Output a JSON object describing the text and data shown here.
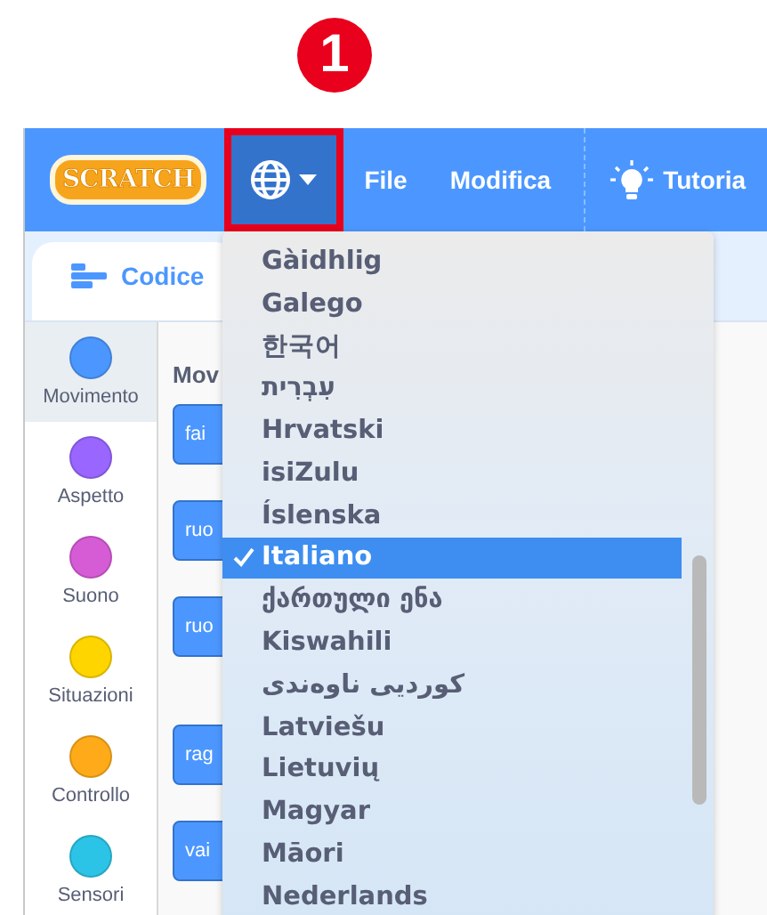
{
  "callout": {
    "label": "1"
  },
  "menu_bar": {
    "items": [
      {
        "kind": "logo",
        "label": "SCRATCH"
      },
      {
        "kind": "language",
        "selected": true
      },
      {
        "kind": "text",
        "label": "File"
      },
      {
        "kind": "text",
        "label": "Modifica"
      },
      {
        "kind": "tutorial",
        "label": "Tutoria"
      }
    ]
  },
  "tabs": [
    {
      "label": "Codice",
      "selected": true
    }
  ],
  "categories": [
    {
      "label": "Movimento",
      "color": "#4c97ff",
      "selected": true
    },
    {
      "label": "Aspetto",
      "color": "#9966ff",
      "selected": false
    },
    {
      "label": "Suono",
      "color": "#d65cd6",
      "selected": false
    },
    {
      "label": "Situazioni",
      "color": "#ffd500",
      "selected": false
    },
    {
      "label": "Controllo",
      "color": "#ffab19",
      "selected": false
    },
    {
      "label": "Sensori",
      "color": "#2cc4e6",
      "selected": false
    }
  ],
  "palette": {
    "heading": "Mov",
    "blocks": [
      "fai",
      "ruo",
      "ruo",
      "rag",
      "vai"
    ]
  },
  "language_menu": {
    "items": [
      {
        "label": "Gàidhlig",
        "selected": false
      },
      {
        "label": "Galego",
        "selected": false
      },
      {
        "label": "한국어",
        "selected": false
      },
      {
        "label": "עִבְרִית",
        "selected": false
      },
      {
        "label": "Hrvatski",
        "selected": false
      },
      {
        "label": "isiZulu",
        "selected": false
      },
      {
        "label": "Íslenska",
        "selected": false
      },
      {
        "label": "Italiano",
        "selected": true
      },
      {
        "label": "ქართული ენა",
        "selected": false
      },
      {
        "label": "Kiswahili",
        "selected": false
      },
      {
        "label": "کوردیی ناوەندی",
        "selected": false
      },
      {
        "label": "Latviešu",
        "selected": false
      },
      {
        "label": "Lietuvių",
        "selected": false
      },
      {
        "label": "Magyar",
        "selected": false
      },
      {
        "label": "Māori",
        "selected": false
      },
      {
        "label": "Nederlands",
        "selected": false
      }
    ]
  }
}
